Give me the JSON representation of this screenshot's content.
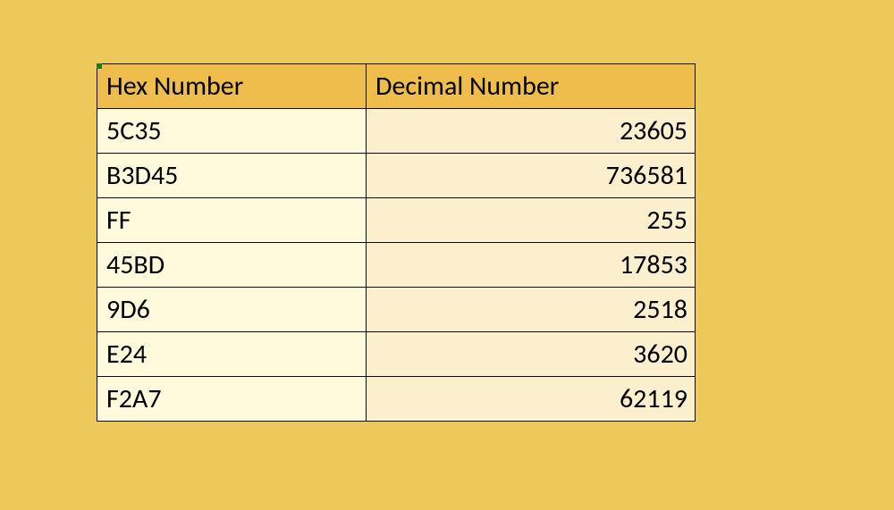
{
  "table": {
    "headers": [
      "Hex Number",
      "Decimal Number"
    ],
    "rows": [
      {
        "hex": "5C35",
        "dec": "23605"
      },
      {
        "hex": "B3D45",
        "dec": "736581"
      },
      {
        "hex": "FF",
        "dec": "255"
      },
      {
        "hex": "45BD",
        "dec": "17853"
      },
      {
        "hex": "9D6",
        "dec": "2518"
      },
      {
        "hex": "E24",
        "dec": "3620"
      },
      {
        "hex": "F2A7",
        "dec": "62119"
      }
    ]
  },
  "chart_data": {
    "type": "table",
    "title": "",
    "columns": [
      "Hex Number",
      "Decimal Number"
    ],
    "rows": [
      [
        "5C35",
        23605
      ],
      [
        "B3D45",
        736581
      ],
      [
        "FF",
        255
      ],
      [
        "45BD",
        17853
      ],
      [
        "9D6",
        2518
      ],
      [
        "E24",
        3620
      ],
      [
        "F2A7",
        62119
      ]
    ]
  }
}
